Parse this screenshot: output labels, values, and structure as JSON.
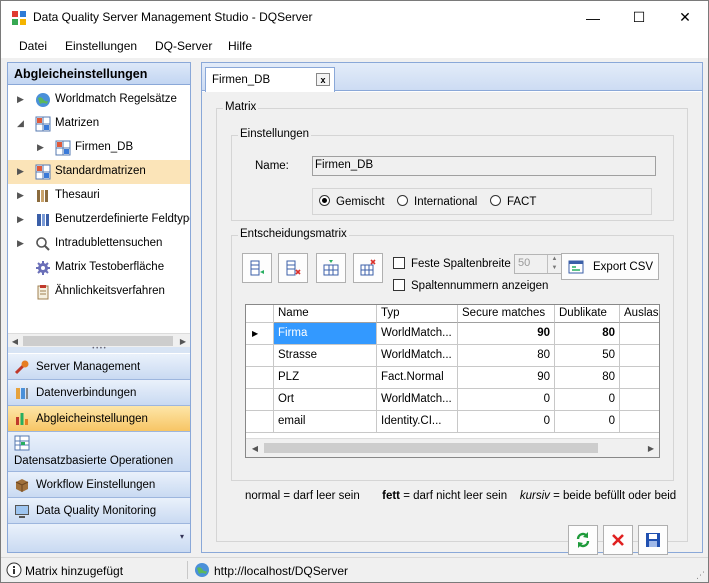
{
  "window": {
    "title": "Data Quality Server Management Studio - DQServer",
    "minimize_glyph": "—",
    "maximize_glyph": "☐",
    "close_glyph": "✕"
  },
  "menu": [
    "Datei",
    "Einstellungen",
    "DQ-Server",
    "Hilfe"
  ],
  "left": {
    "header": "Abgleicheinstellungen",
    "tree": [
      {
        "label": "Worldmatch Regelsätze",
        "icon": "globe-icon",
        "indent": 0,
        "expander": "collapsed"
      },
      {
        "label": "Matrizen",
        "icon": "matrix-icon",
        "indent": 0,
        "expander": "expanded"
      },
      {
        "label": "Firmen_DB",
        "icon": "matrix-icon",
        "indent": 1,
        "expander": "collapsed"
      },
      {
        "label": "Standardmatrizen",
        "icon": "matrix-icon",
        "indent": 0,
        "expander": "collapsed",
        "selected": true
      },
      {
        "label": "Thesauri",
        "icon": "book-icon",
        "indent": 0,
        "expander": "collapsed"
      },
      {
        "label": "Benutzerdefinierte Feldtype",
        "icon": "columns-icon",
        "indent": 0,
        "expander": "collapsed"
      },
      {
        "label": "Intradublettensuchen",
        "icon": "magnifier-icon",
        "indent": 0,
        "expander": "collapsed"
      },
      {
        "label": "Matrix Testoberfläche",
        "icon": "gear-icon",
        "indent": 0,
        "expander": "none"
      },
      {
        "label": "Ähnlichkeitsverfahren",
        "icon": "clipboard-icon",
        "indent": 0,
        "expander": "none"
      }
    ],
    "nav": [
      {
        "label": "Server Management",
        "icon": "wrench-icon"
      },
      {
        "label": "Datenverbindungen",
        "icon": "database-icon"
      },
      {
        "label": "Abgleicheinstellungen",
        "icon": "bars-icon",
        "active": true
      }
    ],
    "nav_big": {
      "label": "Datensatzbasierte Operationen",
      "icon": "grid-icon"
    },
    "nav_bottom": [
      {
        "label": "Workflow Einstellungen",
        "icon": "box-icon"
      },
      {
        "label": "Data Quality Monitoring",
        "icon": "monitor-icon"
      }
    ]
  },
  "doc": {
    "tab_label": "Firmen_DB",
    "tab_close": "x",
    "group_matrix": "Matrix",
    "group_settings": "Einstellungen",
    "name_label": "Name:",
    "name_value": "Firmen_DB",
    "radios": [
      "Gemischt",
      "International",
      "FACT"
    ],
    "radio_selected": 0,
    "group_decision": "Entscheidungsmatrix",
    "fixed_width_label": "Feste Spaltenbreite",
    "fixed_width_value": "50",
    "show_col_numbers_label": "Spaltennummern anzeigen",
    "export_label": "Export CSV",
    "grid": {
      "columns": [
        "Name",
        "Typ",
        "Secure matches",
        "Dublikate",
        "Auslass"
      ],
      "rows": [
        {
          "name": "Firma",
          "typ": "WorldMatch...",
          "secure": "90",
          "dup": "80",
          "bold": true,
          "current": true
        },
        {
          "name": "Strasse",
          "typ": "WorldMatch...",
          "secure": "80",
          "dup": "50"
        },
        {
          "name": "PLZ",
          "typ": "Fact.Normal",
          "secure": "90",
          "dup": "80"
        },
        {
          "name": "Ort",
          "typ": "WorldMatch...",
          "secure": "0",
          "dup": "0"
        },
        {
          "name": "email",
          "typ": "Identity.CI...",
          "secure": "0",
          "dup": "0"
        }
      ]
    },
    "legend": {
      "normal": "normal = darf leer sein",
      "bold_word": "fett",
      "bold_rest": " = darf nicht leer sein",
      "italic_word": "kursiv",
      "italic_rest": " = beide befüllt oder beid"
    }
  },
  "status": {
    "left": "Matrix hinzugefügt",
    "right": "http://localhost/DQServer"
  },
  "colors": {
    "selection": "#3399ff",
    "tree_selected": "#fbe4b8",
    "nav_active": "#f7c565",
    "pane_border": "#8aa8d8"
  }
}
